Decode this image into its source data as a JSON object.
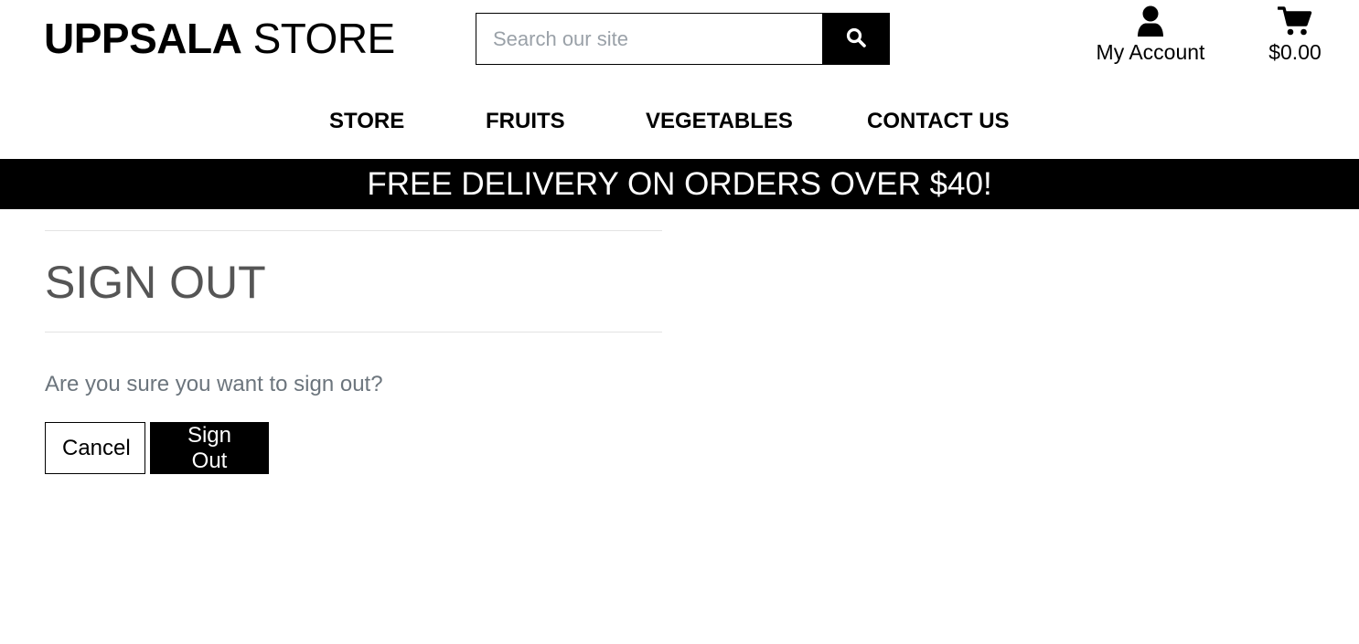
{
  "brand": {
    "name_bold": "UPPSALA",
    "name_light": "STORE"
  },
  "search": {
    "placeholder": "Search our site",
    "value": "",
    "button_icon": "search-icon"
  },
  "account": {
    "icon": "user-icon",
    "label": "My Account"
  },
  "cart": {
    "icon": "shopping-cart-icon",
    "total": "$0.00"
  },
  "nav": {
    "items": [
      {
        "label": "STORE"
      },
      {
        "label": "FRUITS"
      },
      {
        "label": "VEGETABLES"
      },
      {
        "label": "CONTACT US"
      }
    ]
  },
  "banner": {
    "text": "FREE DELIVERY ON ORDERS OVER $40!"
  },
  "main": {
    "title": "SIGN OUT",
    "question": "Are you sure you want to sign out?",
    "cancel_label": "Cancel",
    "signout_label": "Sign Out"
  },
  "colors": {
    "primary": "#000000",
    "background": "#ffffff",
    "title_text": "#555555",
    "muted_text": "#6c757d",
    "divider": "#e3e3e3",
    "placeholder": "#9aa1a8"
  }
}
